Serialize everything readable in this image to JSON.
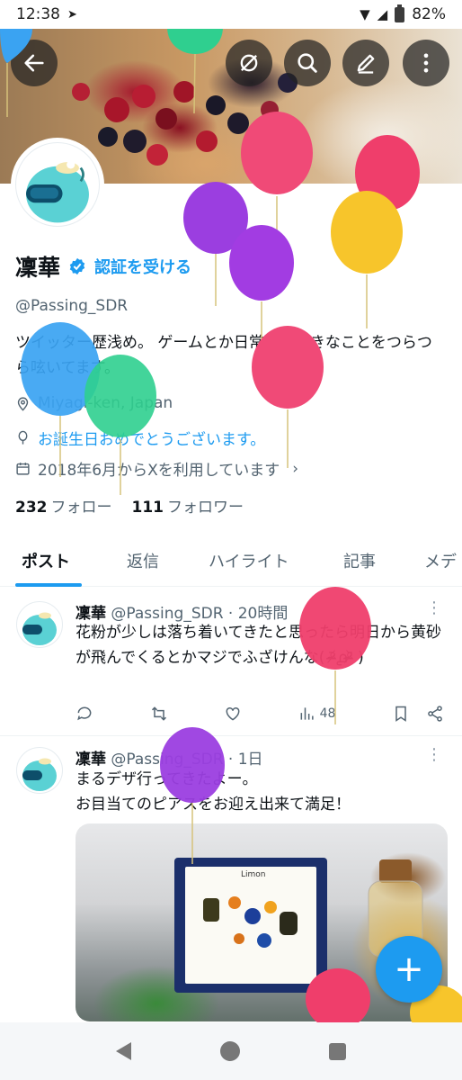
{
  "status_bar": {
    "time": "12:38",
    "battery": "82%"
  },
  "profile": {
    "name": "凜華",
    "verify_link": "認証を受ける",
    "handle": "@Passing_SDR",
    "bio": "ツイッター歴浅め。 ゲームとか日常とか好きなことをつらつら呟いてます。",
    "location": "Miyagi-ken, Japan",
    "birthday": "お誕生日おめでとうございます。",
    "joined": "2018年6月からXを利用しています",
    "following_count": "232",
    "following_label": "フォロー",
    "followers_count": "111",
    "followers_label": "フォロワー"
  },
  "tabs": [
    {
      "label": "ポスト"
    },
    {
      "label": "返信"
    },
    {
      "label": "ハイライト"
    },
    {
      "label": "記事"
    },
    {
      "label": "メデ"
    }
  ],
  "tweets": [
    {
      "name": "凜華",
      "handle_time": "@Passing_SDR · 20時間",
      "text": "花粉が少しは落ち着いてきたと思ったら明日から黄砂が飛んでくるとかマジでふざけんな( ᵒ̴̶̷᷄൧ᵒ̴̶̷᷅ )",
      "views": "48"
    },
    {
      "name": "凜華",
      "handle_time": "@Passing_SDR · 1日",
      "text_line1": "まるデザ行ってきたよー。",
      "text_line2": "お目当てのピアスをお迎え出来て満足！",
      "image_brand": "Limon"
    }
  ],
  "fab_label": "+",
  "icons": {
    "back": "arrow-left-icon",
    "hide": "eye-slash-icon",
    "search": "search-icon",
    "edit": "pencil-icon",
    "more": "more-vertical-icon",
    "verified": "verified-badge-icon",
    "location": "location-pin-icon",
    "birthday": "balloon-icon",
    "calendar": "calendar-icon",
    "reply": "reply-icon",
    "retweet": "retweet-icon",
    "like": "heart-icon",
    "views": "views-icon",
    "bookmark": "bookmark-icon",
    "share": "share-icon"
  },
  "colors": {
    "accent": "#1d9bf0",
    "text": "#0f1419",
    "muted": "#536471"
  }
}
